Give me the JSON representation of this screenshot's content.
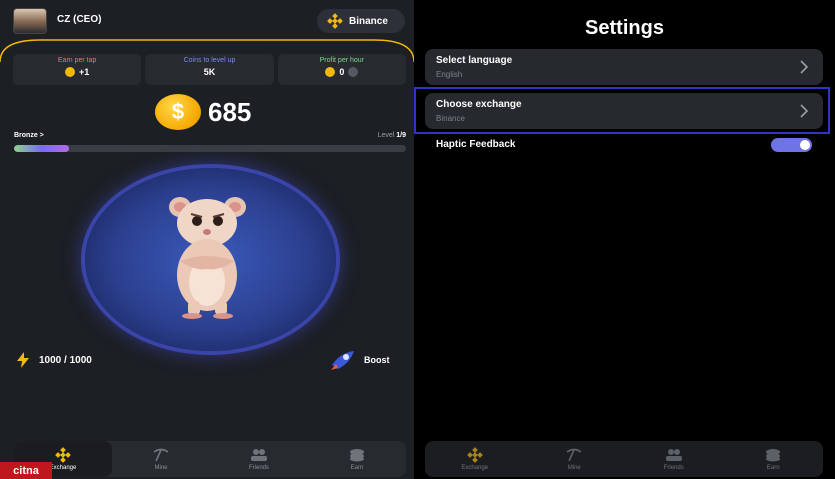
{
  "game": {
    "user_name": "CZ (CEO)",
    "exchange_name": "Binance",
    "stats": [
      {
        "title": "Earn per tap",
        "value": "+1",
        "title_color": "#f0795a"
      },
      {
        "title": "Coins to level up",
        "value": "5K",
        "title_color": "#7a8cf0"
      },
      {
        "title": "Profit per hour",
        "value": "0",
        "title_color": "#7bd98a"
      }
    ],
    "coin_symbol": "$",
    "balance": "685",
    "tier": "Bronze >",
    "level_label": "Level",
    "level_value": "1/9",
    "level_progress": 0.14,
    "energy": "1000 / 1000",
    "boost_label": "Boost"
  },
  "nav": {
    "exchange": "Exchange",
    "mine": "Mine",
    "friends": "Friends",
    "earn": "Earn"
  },
  "settings": {
    "title": "Settings",
    "language_label": "Select language",
    "language_value": "English",
    "exchange_label": "Choose exchange",
    "exchange_value": "Binance",
    "haptic_label": "Haptic Feedback",
    "haptic_on": true
  },
  "watermark": "citna",
  "colors": {
    "binance_gold": "#f0b90b",
    "highlight_border": "#2f33c8",
    "toggle_on": "#6e73e6"
  }
}
